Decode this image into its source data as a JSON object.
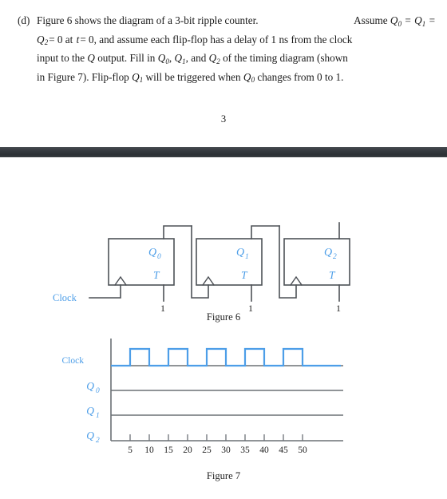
{
  "document": {
    "page_number": "3"
  },
  "question": {
    "marker": "(d)",
    "line1_a": "Figure 6 shows the diagram of a 3-bit ripple counter.",
    "line1_b": "Assume",
    "line1_q0": "Q",
    "line1_q0_sub": "0",
    "line1_eq1": "=",
    "line1_q1": "Q",
    "line1_q1_sub": "1",
    "line1_eq2": "=",
    "line2_q2": "Q",
    "line2_q2_sub": "2",
    "line2_eq": "= 0 at",
    "line2_t": "t",
    "line2_rest": "= 0, and assume each flip-flop has a delay of 1 ns from the clock",
    "line3_a": "input to the",
    "line3_q": "Q",
    "line3_b": "output. Fill in",
    "line3_q0": "Q",
    "line3_q0_sub": "0",
    "line3_c": ",",
    "line3_q1": "Q",
    "line3_q1_sub": "1",
    "line3_d": ", and",
    "line3_q2": "Q",
    "line3_q2_sub": "2",
    "line3_e": "of the timing diagram (shown",
    "line4_a": "in Figure 7). Flip-flop",
    "line4_q1": "Q",
    "line4_q1_sub": "1",
    "line4_b": "will be triggered when",
    "line4_q0": "Q",
    "line4_q0_sub": "0",
    "line4_c": "changes from 0 to 1."
  },
  "figure6": {
    "caption": "Figure 6",
    "clock_label": "Clock",
    "flipflops": [
      {
        "q_label": "Q",
        "q_sub": "0",
        "t_label": "T",
        "t_input_value": "1"
      },
      {
        "q_label": "Q",
        "q_sub": "1",
        "t_label": "T",
        "t_input_value": "1"
      },
      {
        "q_label": "Q",
        "q_sub": "2",
        "t_label": "T",
        "t_input_value": "1"
      }
    ]
  },
  "figure7": {
    "caption": "Figure 7",
    "row_labels": [
      {
        "text": "Clock",
        "sub": ""
      },
      {
        "text": "Q",
        "sub": "0"
      },
      {
        "text": "Q",
        "sub": "1"
      },
      {
        "text": "Q",
        "sub": "2"
      }
    ],
    "axis_ticks": [
      "5",
      "10",
      "15",
      "20",
      "25",
      "30",
      "35",
      "40",
      "45",
      "50"
    ],
    "axis_unit_ns_per_tick": 5
  },
  "colors": {
    "signal_blue": "#4d9ee8",
    "wire_gray": "#4d5156",
    "baseline_gray": "#6b7075",
    "separator_dark": "#33383d",
    "text_black": "#1a1a1a"
  },
  "chart_data": {
    "type": "line",
    "title": "Figure 7",
    "xlabel": "",
    "ylabel": "",
    "xlim": [
      0,
      55
    ],
    "x_ticks": [
      5,
      10,
      15,
      20,
      25,
      30,
      35,
      40,
      45,
      50
    ],
    "grid": false,
    "legend": "none",
    "series": [
      {
        "name": "Clock",
        "type": "digital-waveform",
        "drawn": true,
        "levels": [
          {
            "t_start": 0,
            "t_end": 5,
            "value": 0
          },
          {
            "t_start": 5,
            "t_end": 10,
            "value": 1
          },
          {
            "t_start": 10,
            "t_end": 15,
            "value": 0
          },
          {
            "t_start": 15,
            "t_end": 20,
            "value": 1
          },
          {
            "t_start": 20,
            "t_end": 25,
            "value": 0
          },
          {
            "t_start": 25,
            "t_end": 30,
            "value": 1
          },
          {
            "t_start": 30,
            "t_end": 35,
            "value": 0
          },
          {
            "t_start": 35,
            "t_end": 40,
            "value": 1
          },
          {
            "t_start": 40,
            "t_end": 45,
            "value": 0
          },
          {
            "t_start": 45,
            "t_end": 50,
            "value": 1
          },
          {
            "t_start": 50,
            "t_end": 54,
            "value": 0
          }
        ]
      },
      {
        "name": "Q0",
        "type": "digital-waveform",
        "drawn": false,
        "levels": []
      },
      {
        "name": "Q1",
        "type": "digital-waveform",
        "drawn": false,
        "levels": []
      },
      {
        "name": "Q2",
        "type": "digital-waveform",
        "drawn": false,
        "levels": []
      }
    ]
  }
}
